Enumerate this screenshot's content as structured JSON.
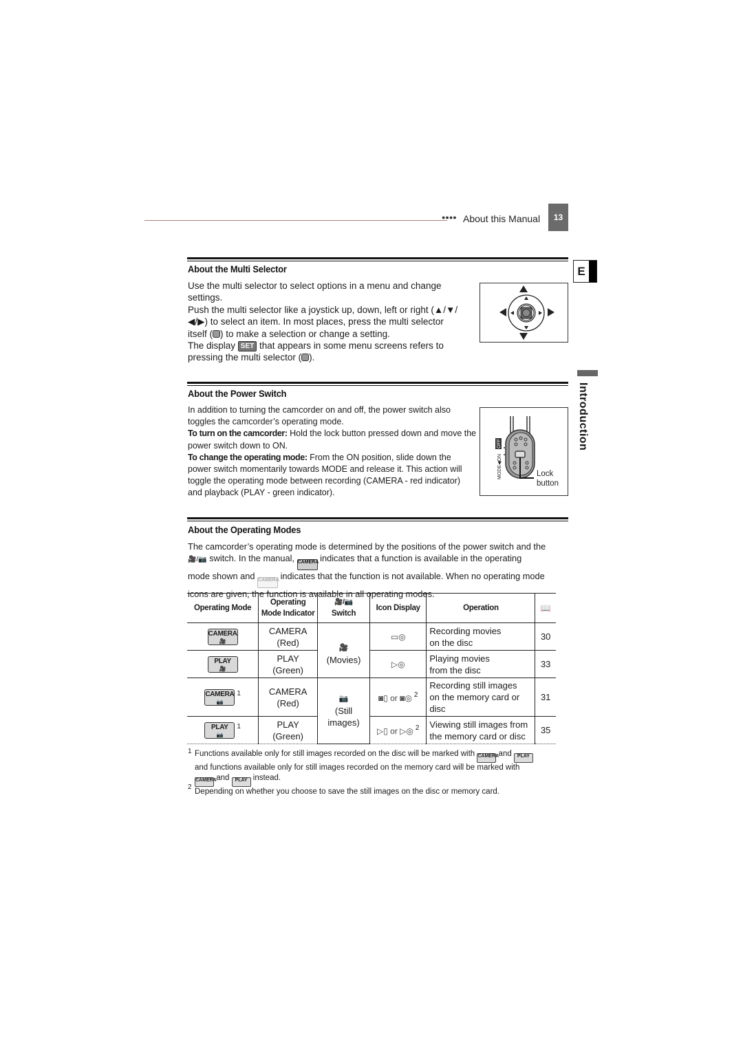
{
  "header": {
    "dots": "●●●●",
    "section_title": "About this Manual",
    "page_number": "13"
  },
  "side_tabs": {
    "language": "E",
    "chapter": "Introduction"
  },
  "multi_selector": {
    "title": "About the Multi Selector",
    "para1": "Use the multi selector to select options in a menu and change settings.",
    "para2_a": "Push the multi selector like a joystick up, down, left or right (▲/▼/",
    "para2_b": "◀/▶) to select an item. In most places, press the multi selector",
    "para2_c_pre": "itself (",
    "para2_c_post": ") to make a selection or change a setting.",
    "para3_pre": "The display ",
    "set_badge": "SET",
    "para3_post": " that appears in some menu screens refers to",
    "para3_b_pre": "pressing the multi selector (",
    "para3_b_post": ")."
  },
  "power_switch": {
    "title": "About the Power Switch",
    "intro": "In addition to turning the camcorder on and off, the power switch also toggles the camcorder’s operating mode.",
    "turn_on_label": "To turn on the camcorder:",
    "turn_on_text": " Hold the lock button pressed down and move the power switch down to ON.",
    "change_label": "To change the operating mode:",
    "change_text": " From the ON position, slide down the power switch momentarily towards MODE and release it. This action will toggle the operating mode between recording (CAMERA - red indicator) and playback (PLAY - green indicator).",
    "figure": {
      "switch_label": "MODE◀ON OFF",
      "lock_label_1": "Lock",
      "lock_label_2": "button"
    }
  },
  "operating_modes": {
    "title": "About the Operating Modes",
    "p_line1": "The camcorder’s operating mode is determined by the positions of the power switch and the",
    "p_line2_icon": "🎥/📷",
    "p_line2_a": " switch. In the manual, ",
    "badge_active": "CAMERA",
    "p_line2_b": " indicates that a function is available in the operating",
    "p_line3_a": "mode shown and ",
    "badge_inactive": "CAMERA",
    "p_line3_b": " indicates that the function is not available. When no operating mode",
    "p_line4": "icons are given, the function is available in all operating modes."
  },
  "table": {
    "headers": {
      "mode": "Operating Mode",
      "indicator_1": "Operating",
      "indicator_2": "Mode Indicator",
      "switch_icon": "🎥/📷",
      "switch": "Switch",
      "icon_display": "Icon Display",
      "operation": "Operation",
      "page_icon": "📖"
    },
    "rows": [
      {
        "badge": "CAMERA",
        "badge_icon": "🎥",
        "sup": "",
        "indicator_1": "CAMERA",
        "indicator_2": "(Red)",
        "icon_display": "▭◎",
        "operation_1": "Recording movies",
        "operation_2": "on the disc",
        "operation_3": "",
        "page": "30"
      },
      {
        "badge": "PLAY",
        "badge_icon": "🎥",
        "sup": "",
        "indicator_1": "PLAY",
        "indicator_2": "(Green)",
        "icon_display": "▷◎",
        "operation_1": "Playing movies",
        "operation_2": "from the disc",
        "operation_3": "",
        "page": "33"
      },
      {
        "badge": "CAMERA",
        "badge_icon": "📷",
        "sup": "1",
        "indicator_1": "CAMERA",
        "indicator_2": "(Red)",
        "icon_display": "◙▯ or ◙◎",
        "icon_sup": "2",
        "operation_1": "Recording still images",
        "operation_2": "on the memory card or",
        "operation_3": "disc",
        "page": "31"
      },
      {
        "badge": "PLAY",
        "badge_icon": "📷",
        "sup": "1",
        "indicator_1": "PLAY",
        "indicator_2": "(Green)",
        "icon_display": "▷▯ or ▷◎",
        "icon_sup": "2",
        "operation_1": "Viewing still images from",
        "operation_2": "the memory card or disc",
        "operation_3": "",
        "page": "35"
      }
    ],
    "switch_groups": [
      {
        "icon": "🎥",
        "label": "(Movies)"
      },
      {
        "icon": "📷",
        "label_1": "(Still",
        "label_2": "images)"
      }
    ]
  },
  "footnotes": {
    "fn1_num": "1",
    "fn1_a": "Functions available only for still images recorded on the disc will be marked with ",
    "fn1_badge1": "CAMERA",
    "fn1_and1": " and ",
    "fn1_badge2": "PLAY",
    "fn1_b": "and functions available only for still images recorded on the memory card will be marked with",
    "fn1_badge3": "CAMERA",
    "fn1_and2": " and ",
    "fn1_badge4": "PLAY",
    "fn1_c": " instead.",
    "fn2_num": "2",
    "fn2": "Depending on whether you choose to save the still images on the disc or memory card."
  }
}
